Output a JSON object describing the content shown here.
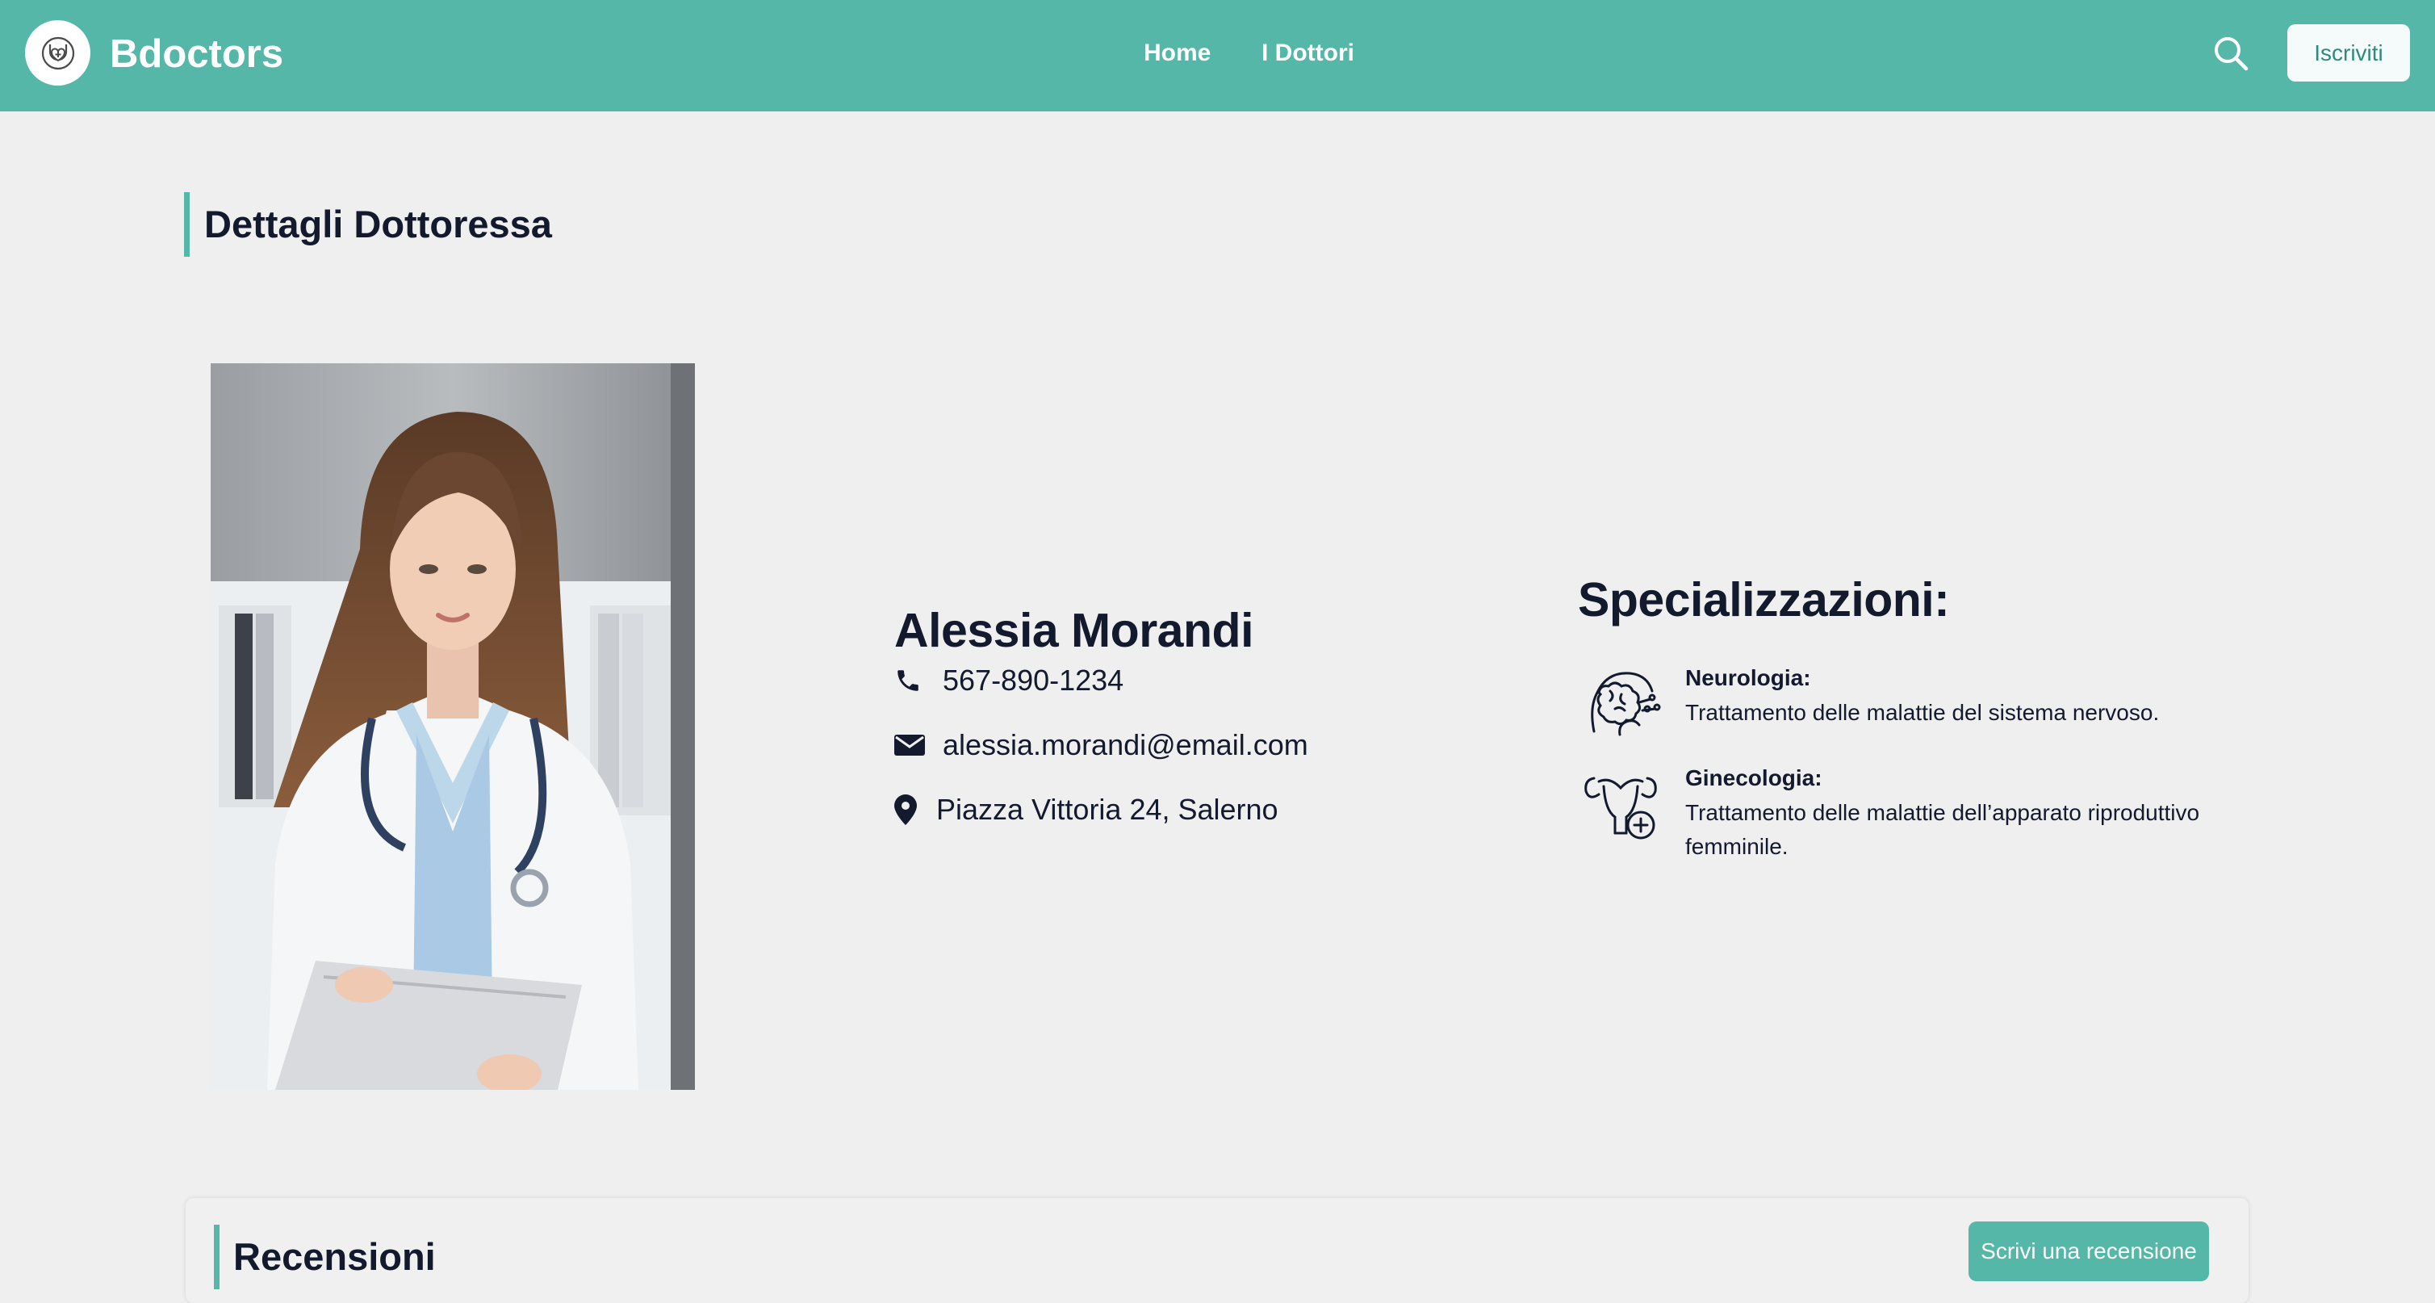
{
  "navbar": {
    "brand": "Bdoctors",
    "links": [
      "Home",
      "I Dottori"
    ],
    "signup_label": "Iscriviti",
    "accent_color": "#55b7a8"
  },
  "page": {
    "title": "Dettagli Dottoressa"
  },
  "doctor": {
    "name": "Alessia Morandi",
    "phone": "567-890-1234",
    "email": "alessia.morandi@email.com",
    "address": "Piazza Vittoria 24, Salerno"
  },
  "specializations": {
    "heading": "Specializzazioni:",
    "items": [
      {
        "name": "Neurologia:",
        "description": "Trattamento delle malattie del sistema nervoso.",
        "icon": "brain-icon"
      },
      {
        "name": "Ginecologia:",
        "description": "Trattamento delle malattie dell’apparato riproduttivo femminile.",
        "icon": "uterus-icon"
      }
    ]
  },
  "reviews": {
    "title": "Recensioni",
    "write_button": "Scrivi una recensione"
  }
}
